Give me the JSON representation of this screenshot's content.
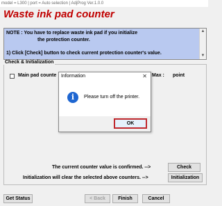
{
  "window": {
    "title": "model = L300 | port = Auto selection | AdjProg Ver.1.0.0"
  },
  "page": {
    "heading": "Waste ink pad counter",
    "heading_color": "#c00000"
  },
  "note": {
    "line1": "NOTE : You have to replace waste ink pad if you initialize",
    "line2": "the protection counter.",
    "line3": "1) Click [Check] button to check current protection counter's value.",
    "background": "#b9c9f0"
  },
  "check_init": {
    "group_label": "Check & Initialization",
    "main_pad_label": "Main pad counte",
    "max_label": "Max :",
    "point_label": "point",
    "confirm_text": "The current counter value is confirmed. -->",
    "check_button": "Check",
    "init_text": "Initialization will clear the selected above counters. -->",
    "init_button": "Initialization"
  },
  "footer": {
    "get_status": "Get Status",
    "back": "< Back",
    "finish": "Finish",
    "cancel": "Cancel"
  },
  "dialog": {
    "title": "Information",
    "close": "✕",
    "icon": "information-icon",
    "icon_glyph": "i",
    "message": "Please turn off the printer.",
    "ok": "OK"
  }
}
